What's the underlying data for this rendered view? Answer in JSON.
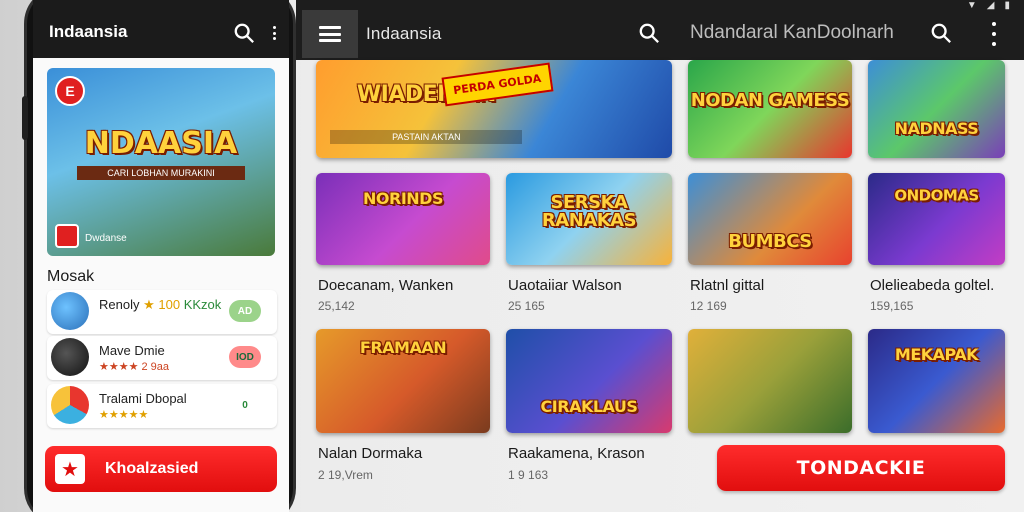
{
  "app": {
    "title": "Indaansia",
    "header_title": "Ndandaral KanDoolnarh"
  },
  "phone": {
    "title": "Indaansia",
    "hero": {
      "title": "NDAASIA",
      "subtitle": "CARI LOBHAN MURAKINI",
      "brand": "Dwdanse"
    },
    "section": "Mosak",
    "items": [
      {
        "name": "Renoly",
        "rating": "★ 100",
        "extra": "KKzok",
        "pill": "AD",
        "pill_color": "#9bd38a",
        "icon_color": "#3a8fd8"
      },
      {
        "name": "Mave Dmie",
        "rating": "★★★★ 2 9aa",
        "extra": "",
        "pill": "IOD",
        "pill_color": "#ff8a8a",
        "icon_color": "#2a2a2a"
      },
      {
        "name": "Tralami Dbopal",
        "rating": "★★★★★",
        "extra": "",
        "pill": "0",
        "pill_color": "#ffffff",
        "icon_color": "#3bb0e0"
      }
    ],
    "cta": "Khoalzasied"
  },
  "grid": {
    "row1": [
      {
        "title": "WIADEIKAN",
        "sub": "PASTAIN AKTAN",
        "badge": "PERDA GOLDA",
        "colors": [
          "#ff9d2e",
          "#1f4aa8"
        ]
      },
      {
        "title": "NODAN GAMESS",
        "sub": "",
        "colors": [
          "#2aa64a",
          "#e8362e"
        ]
      },
      {
        "title": "NADNASS",
        "sub": "",
        "colors": [
          "#3d8fd6",
          "#7a3fb8"
        ]
      }
    ],
    "row2": [
      {
        "title": "NORINDS",
        "label": "Doecanam, Wanken",
        "meta": "25,142",
        "colors": [
          "#7a2fb8",
          "#e04b8a"
        ]
      },
      {
        "title": "SERSKA RANAKAS",
        "label": "Uaotaiiar Walson",
        "meta": "25 165",
        "colors": [
          "#2a9ae0",
          "#f7b23a"
        ]
      },
      {
        "title": "BUMBCS",
        "label": "Rlatnl gittal",
        "meta": "12 169",
        "colors": [
          "#3d8fd6",
          "#e8422e"
        ]
      },
      {
        "title": "ONDOMAS",
        "label": "Olelieabeda goltel.",
        "meta": "159,165",
        "colors": [
          "#2b2a88",
          "#c33dc4"
        ]
      }
    ],
    "row3": [
      {
        "title": "FRAMAAN",
        "label": "Nalan Dormaka",
        "meta": "2 19,Vrem",
        "colors": [
          "#e69a2a",
          "#7a3b1e"
        ]
      },
      {
        "title": "CIRAKLAUS",
        "label": "Raakamena, Krason",
        "meta": "1 9 163",
        "colors": [
          "#1f4fa8",
          "#d83a6e"
        ]
      },
      {
        "title": "",
        "label": "",
        "meta": "",
        "colors": [
          "#e0b03a",
          "#3b6d2a"
        ]
      },
      {
        "title": "MEKAPAK",
        "label": "",
        "meta": "",
        "colors": [
          "#2b2a88",
          "#e86a2e"
        ]
      }
    ],
    "cta": "TONDACKIE"
  },
  "icons": {
    "menu": "menu-icon",
    "search": "search-icon",
    "more": "more-vert-icon"
  }
}
